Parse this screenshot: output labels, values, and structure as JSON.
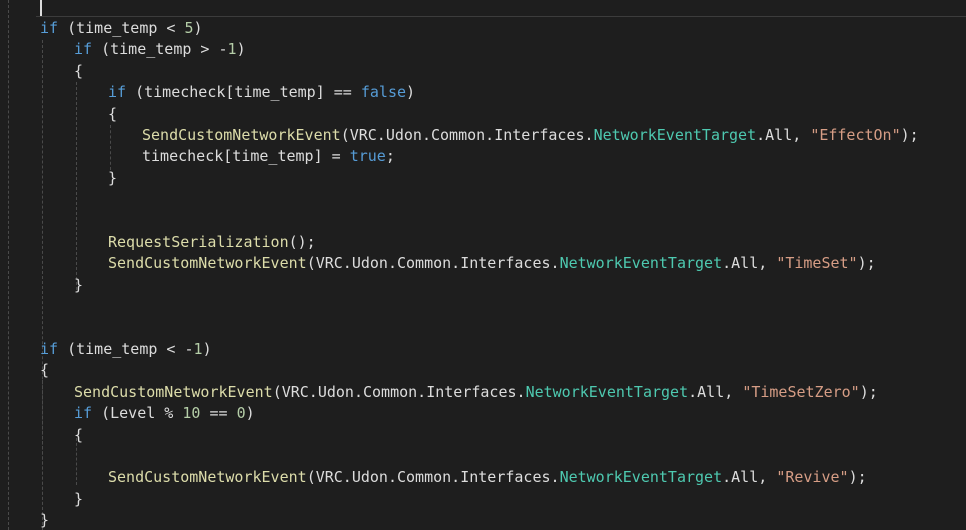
{
  "editor": {
    "theme_colors": {
      "background": "#1e1e1e",
      "keyword": "#569cd6",
      "method": "#dcdcaa",
      "type": "#4ec9b0",
      "number": "#b5cea8",
      "string": "#d69d85",
      "text": "#dcdcdc"
    },
    "lines": [
      {
        "tokens": [
          {
            "t": "if",
            "k": "kw"
          },
          {
            "t": " (time_temp < ",
            "k": "txt"
          },
          {
            "t": "5",
            "k": "num"
          },
          {
            "t": ")",
            "k": "txt"
          }
        ]
      },
      {
        "tokens": [
          {
            "t": "if",
            "k": "kw"
          },
          {
            "t": " (time_temp > -",
            "k": "txt"
          },
          {
            "t": "1",
            "k": "num"
          },
          {
            "t": ")",
            "k": "txt"
          }
        ]
      },
      {
        "tokens": [
          {
            "t": "{",
            "k": "txt"
          }
        ]
      },
      {
        "tokens": [
          {
            "t": "if",
            "k": "kw"
          },
          {
            "t": " (timecheck[time_temp] == ",
            "k": "txt"
          },
          {
            "t": "false",
            "k": "kw"
          },
          {
            "t": ")",
            "k": "txt"
          }
        ]
      },
      {
        "tokens": [
          {
            "t": "{",
            "k": "txt"
          }
        ]
      },
      {
        "tokens": [
          {
            "t": "SendCustomNetworkEvent",
            "k": "fn"
          },
          {
            "t": "(VRC.Udon.Common.Interfaces.",
            "k": "txt"
          },
          {
            "t": "NetworkEventTarget",
            "k": "ty"
          },
          {
            "t": ".All, ",
            "k": "txt"
          },
          {
            "t": "\"EffectOn\"",
            "k": "str"
          },
          {
            "t": ");",
            "k": "txt"
          }
        ]
      },
      {
        "tokens": [
          {
            "t": "timecheck[time_temp] = ",
            "k": "txt"
          },
          {
            "t": "true",
            "k": "kw"
          },
          {
            "t": ";",
            "k": "txt"
          }
        ]
      },
      {
        "tokens": [
          {
            "t": "}",
            "k": "txt"
          }
        ]
      },
      {
        "tokens": []
      },
      {
        "tokens": []
      },
      {
        "tokens": [
          {
            "t": "RequestSerialization",
            "k": "fn"
          },
          {
            "t": "();",
            "k": "txt"
          }
        ]
      },
      {
        "tokens": [
          {
            "t": "SendCustomNetworkEvent",
            "k": "fn"
          },
          {
            "t": "(VRC.Udon.Common.Interfaces.",
            "k": "txt"
          },
          {
            "t": "NetworkEventTarget",
            "k": "ty"
          },
          {
            "t": ".All, ",
            "k": "txt"
          },
          {
            "t": "\"TimeSet\"",
            "k": "str"
          },
          {
            "t": ");",
            "k": "txt"
          }
        ]
      },
      {
        "tokens": [
          {
            "t": "}",
            "k": "txt"
          }
        ]
      },
      {
        "tokens": []
      },
      {
        "tokens": []
      },
      {
        "tokens": [
          {
            "t": "if",
            "k": "kw"
          },
          {
            "t": " (time_temp < -",
            "k": "txt"
          },
          {
            "t": "1",
            "k": "num"
          },
          {
            "t": ")",
            "k": "txt"
          }
        ]
      },
      {
        "tokens": [
          {
            "t": "{",
            "k": "txt"
          }
        ]
      },
      {
        "tokens": [
          {
            "t": "SendCustomNetworkEvent",
            "k": "fn"
          },
          {
            "t": "(VRC.Udon.Common.Interfaces.",
            "k": "txt"
          },
          {
            "t": "NetworkEventTarget",
            "k": "ty"
          },
          {
            "t": ".All, ",
            "k": "txt"
          },
          {
            "t": "\"TimeSetZero\"",
            "k": "str"
          },
          {
            "t": ");",
            "k": "txt"
          }
        ]
      },
      {
        "tokens": [
          {
            "t": "if",
            "k": "kw"
          },
          {
            "t": " (Level % ",
            "k": "txt"
          },
          {
            "t": "10",
            "k": "num"
          },
          {
            "t": " == ",
            "k": "txt"
          },
          {
            "t": "0",
            "k": "num"
          },
          {
            "t": ")",
            "k": "txt"
          }
        ]
      },
      {
        "tokens": [
          {
            "t": "{",
            "k": "txt"
          }
        ]
      },
      {
        "tokens": []
      },
      {
        "tokens": [
          {
            "t": "SendCustomNetworkEvent",
            "k": "fn"
          },
          {
            "t": "(VRC.Udon.Common.Interfaces.",
            "k": "txt"
          },
          {
            "t": "NetworkEventTarget",
            "k": "ty"
          },
          {
            "t": ".All, ",
            "k": "txt"
          },
          {
            "t": "\"Revive\"",
            "k": "str"
          },
          {
            "t": ");",
            "k": "txt"
          }
        ]
      },
      {
        "tokens": [
          {
            "t": "}",
            "k": "txt"
          }
        ]
      },
      {
        "tokens": [
          {
            "t": "}",
            "k": "txt"
          }
        ]
      }
    ]
  }
}
